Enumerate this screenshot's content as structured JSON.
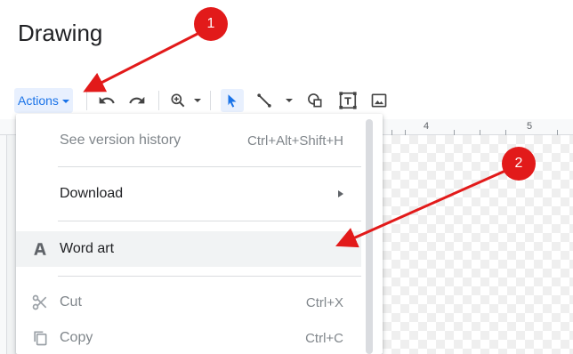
{
  "app": {
    "title": "Drawing"
  },
  "toolbar": {
    "actions_label": "Actions",
    "icons": [
      "undo-icon",
      "redo-icon",
      "zoom-icon",
      "select-icon",
      "line-icon",
      "shape-icon",
      "text-box-icon",
      "image-icon"
    ]
  },
  "ruler": {
    "marks": [
      "4",
      "5"
    ]
  },
  "menu": {
    "items": [
      {
        "label": "See version history",
        "shortcut": "Ctrl+Alt+Shift+H"
      },
      {
        "label": "Download"
      },
      {
        "label": "Word art"
      },
      {
        "label": "Cut",
        "shortcut": "Ctrl+X"
      },
      {
        "label": "Copy",
        "shortcut": "Ctrl+C"
      }
    ]
  },
  "annotations": {
    "steps": [
      "1",
      "2"
    ],
    "color": "#e21a1a"
  },
  "colors": {
    "accent": "#1a73e8",
    "accent_bg": "#e8f0fe",
    "hover": "#f1f3f4"
  }
}
